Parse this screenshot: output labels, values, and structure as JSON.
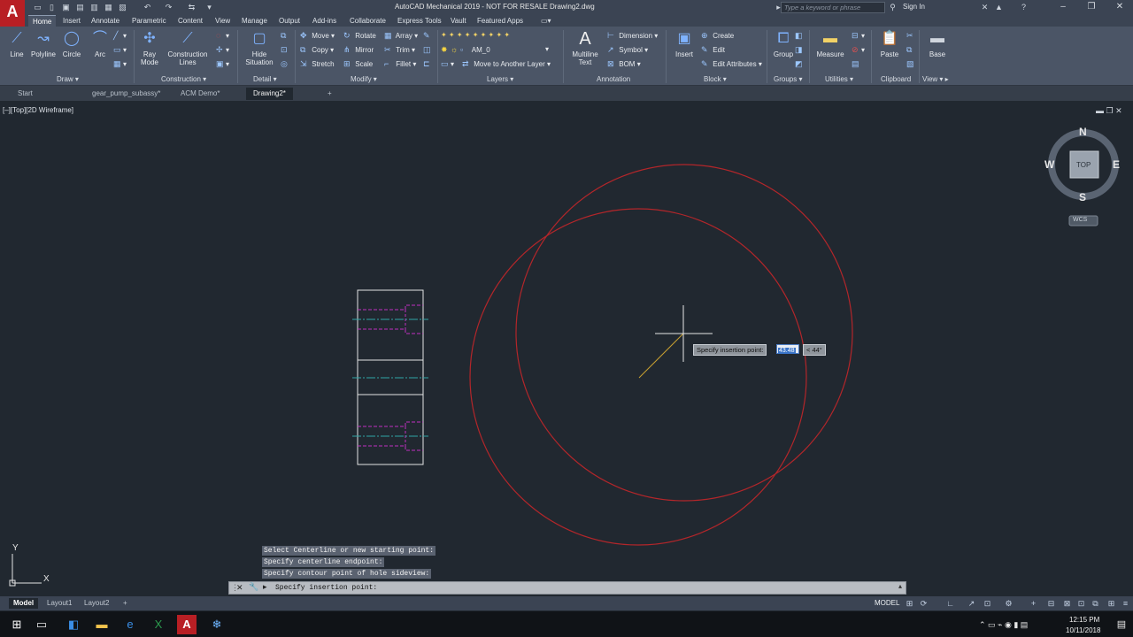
{
  "app": {
    "logo": "A",
    "title": "AutoCAD Mechanical 2019 - NOT FOR RESALE    Drawing2.dwg",
    "search_placeholder": "Type a keyword or phrase",
    "sign_in": "Sign In"
  },
  "ribbon_tabs": [
    "Home",
    "Insert",
    "Annotate",
    "Parametric",
    "Content",
    "View",
    "Manage",
    "Output",
    "Add-ins",
    "Collaborate",
    "Express Tools",
    "Vault",
    "Featured Apps"
  ],
  "ribbon": {
    "draw": {
      "title": "Draw",
      "line": "Line",
      "polyline": "Polyline",
      "circle": "Circle",
      "arc": "Arc"
    },
    "construction": {
      "title": "Construction",
      "ray_mode": "Ray\nMode",
      "construction_lines": "Construction\nLines"
    },
    "detail": {
      "title": "Detail",
      "hide_situation": "Hide\nSituation"
    },
    "modify": {
      "title": "Modify",
      "move": "Move",
      "rotate": "Rotate",
      "array": "Array",
      "copy": "Copy",
      "mirror": "Mirror",
      "trim": "Trim",
      "stretch": "Stretch",
      "scale": "Scale",
      "fillet": "Fillet"
    },
    "layers": {
      "title": "Layers",
      "current_layer": "AM_0",
      "move_to_layer": "Move to Another Layer"
    },
    "annotation": {
      "title": "Annotation",
      "multiline_text": "Multiline\nText",
      "dimension": "Dimension",
      "symbol": "Symbol",
      "bom": "BOM"
    },
    "block": {
      "title": "Block",
      "insert": "Insert",
      "create": "Create",
      "edit": "Edit",
      "edit_attributes": "Edit Attributes"
    },
    "groups": {
      "title": "Groups",
      "group": "Group"
    },
    "utilities": {
      "title": "Utilities",
      "measure": "Measure"
    },
    "clipboard": {
      "title": "Clipboard",
      "paste": "Paste"
    },
    "view": {
      "title": "View",
      "base": "Base"
    }
  },
  "doc_tabs": [
    "Start",
    "gear_pump_subassy*",
    "ACM Demo*",
    "Drawing2*"
  ],
  "viewport_label": "[–][Top][2D Wireframe]",
  "viewcube": {
    "n": "N",
    "s": "S",
    "e": "E",
    "w": "W",
    "top": "TOP",
    "wcs": "WCS"
  },
  "ucs": {
    "x": "X",
    "y": "Y"
  },
  "dynamic_input": {
    "prompt": "Specify insertion point:",
    "value": "43.48",
    "angle": "< 44°"
  },
  "command_history": [
    "Select Centerline or new starting point:",
    "Specify centerline endpoint:",
    "Specify contour point of hole sideview:"
  ],
  "command_line": "Specify insertion point:",
  "layout_tabs": [
    "Model",
    "Layout1",
    "Layout2"
  ],
  "status": {
    "model": "MODEL"
  },
  "clock": {
    "time": "12:15 PM",
    "date": "10/11/2018"
  },
  "colors": {
    "accent": "#b81f24",
    "circle": "#b3262a",
    "centerline": "#2fa6a6",
    "hidden": "#c02fc0",
    "rubberband": "#c8a030"
  }
}
